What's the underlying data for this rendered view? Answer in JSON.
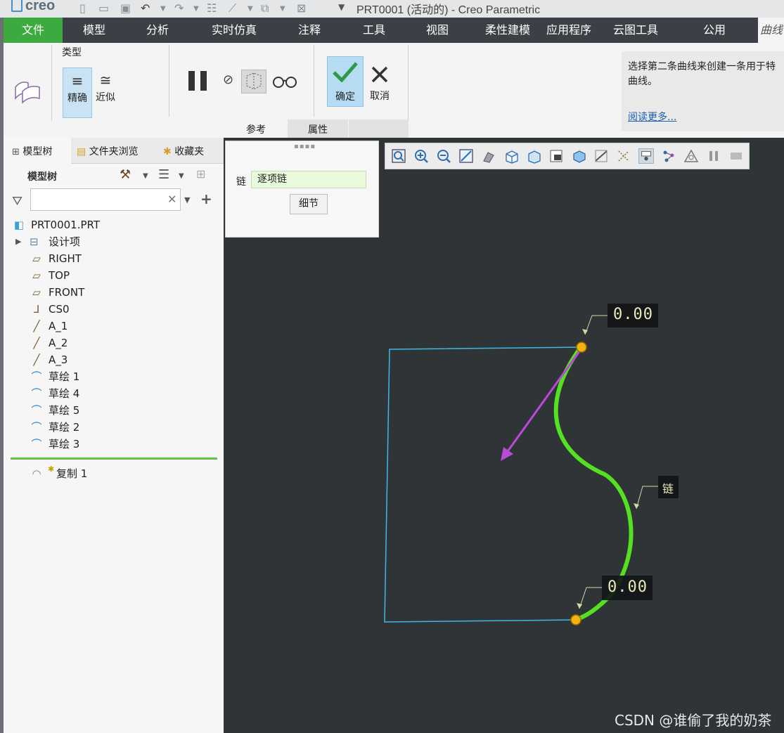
{
  "titlebar": {
    "logo": "creo",
    "title": "PRT0001 (活动的) - Creo Parametric"
  },
  "menu": {
    "tabs": [
      "文件",
      "模型",
      "分析",
      "实时仿真",
      "注释",
      "工具",
      "视图",
      "柔性建模",
      "应用程序",
      "云图工具",
      "公用"
    ],
    "active_tab": "曲线"
  },
  "ribbon": {
    "type_group_label": "类型",
    "exact_label": "精确",
    "approx_label": "近似",
    "ok_label": "确定",
    "cancel_label": "取消",
    "tab_refs": "参考",
    "tab_props": "属性",
    "message": "选择第二条曲线来创建一条用于特曲线。",
    "read_more": "阅读更多..."
  },
  "left_panel": {
    "tabs": [
      "模型树",
      "文件夹浏览",
      "收藏夹"
    ],
    "tree_title": "模型树",
    "search_placeholder": "",
    "root": "PRT0001.PRT",
    "items": [
      "设计项",
      "RIGHT",
      "TOP",
      "FRONT",
      "CS0",
      "A_1",
      "A_2",
      "A_3",
      "草绘 1",
      "草绘 4",
      "草绘 5",
      "草绘 2",
      "草绘 3"
    ],
    "new_feature": "复制 1"
  },
  "dashboard": {
    "chain_label": "链",
    "chain_value": "逐项链",
    "detail_button": "细节"
  },
  "graphics": {
    "dim_top": "0.00",
    "dim_bottom": "0.00",
    "chain_tag": "链",
    "watermark": "CSDN @谁偷了我的奶茶"
  },
  "colors": {
    "accent_green": "#3daa3f",
    "curve_green": "#55e021",
    "sketch_blue": "#3fb8e6",
    "arrow_magenta": "#b84ad6",
    "point_yellow": "#f3b311"
  }
}
